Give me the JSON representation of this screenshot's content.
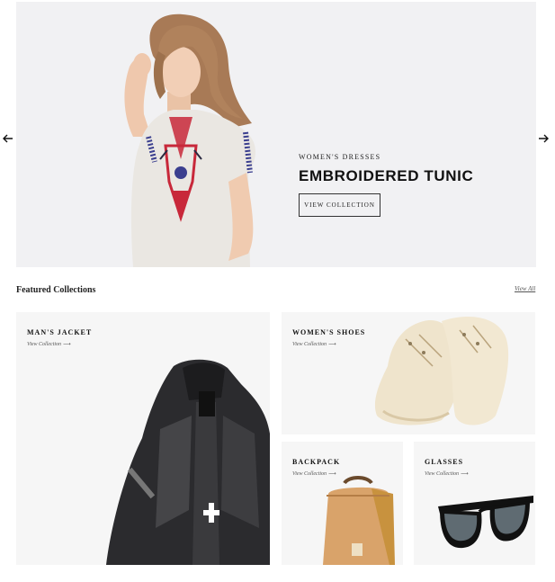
{
  "hero": {
    "eyebrow": "WOMEN'S DRESSES",
    "title": "EMBROIDERED TUNIC",
    "button_label": "VIEW COLLECTION"
  },
  "featured": {
    "title": "Featured Collections",
    "view_all": "View All"
  },
  "tiles": [
    {
      "title": "MAN'S JACKET",
      "link": "View Collection"
    },
    {
      "title": "WOMEN'S SHOES",
      "link": "View Collection"
    },
    {
      "title": "BACKPACK",
      "link": "View Collection"
    },
    {
      "title": "GLASSES",
      "link": "View Collection"
    }
  ],
  "icons": {
    "prev": "arrow-left-icon",
    "next": "arrow-right-icon",
    "link_arrow": "arrow-right-small-icon"
  },
  "colors": {
    "hero_bg": "#f1f1f3",
    "tile_bg": "#f6f6f6",
    "text": "#222222",
    "accent_red": "#c8283a",
    "accent_blue": "#3b3f8f"
  }
}
